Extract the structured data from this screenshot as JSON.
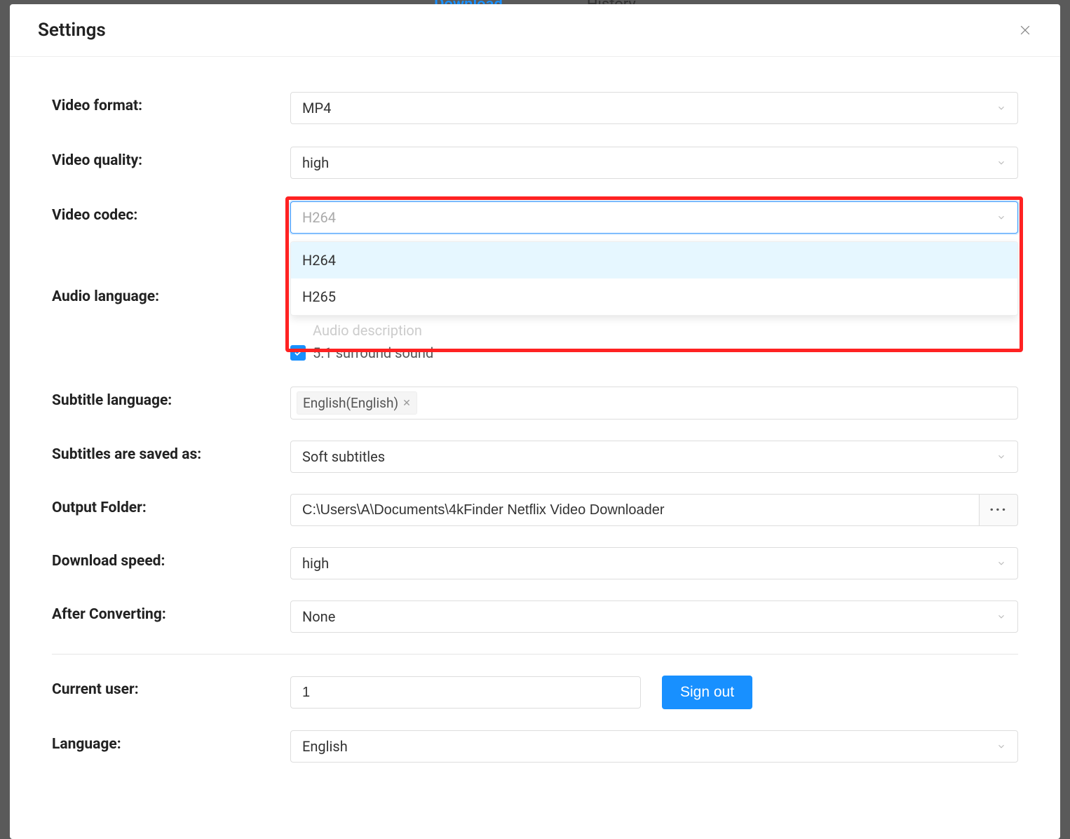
{
  "header": {
    "title": "Settings"
  },
  "fields": {
    "video_format": {
      "label": "Video format:",
      "value": "MP4"
    },
    "video_quality": {
      "label": "Video quality:",
      "value": "high"
    },
    "video_codec": {
      "label": "Video codec:",
      "value": "H264",
      "options": [
        "H264",
        "H265"
      ]
    },
    "audio_language": {
      "label": "Audio language:",
      "audio_description_label": "Audio description",
      "surround_label": "5.1 surround sound",
      "surround_checked": true
    },
    "subtitle_language": {
      "label": "Subtitle language:",
      "tag": "English(English)"
    },
    "subtitles_saved_as": {
      "label": "Subtitles are saved as:",
      "value": "Soft subtitles"
    },
    "output_folder": {
      "label": "Output Folder:",
      "value": "C:\\Users\\A\\Documents\\4kFinder Netflix Video Downloader"
    },
    "download_speed": {
      "label": "Download speed:",
      "value": "high"
    },
    "after_converting": {
      "label": "After Converting:",
      "value": "None"
    },
    "current_user": {
      "label": "Current user:",
      "value": "1",
      "signout": "Sign out"
    },
    "language": {
      "label": "Language:",
      "value": "English"
    }
  },
  "background_tabs": {
    "download": "Download",
    "history": "History"
  },
  "icons": {
    "browse": "···"
  }
}
